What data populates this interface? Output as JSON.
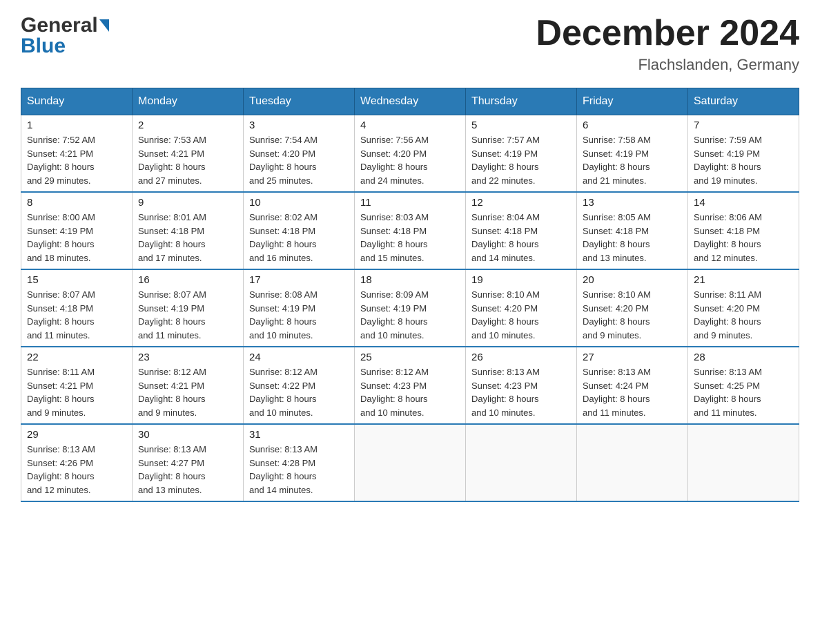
{
  "header": {
    "month_year": "December 2024",
    "location": "Flachslanden, Germany",
    "logo_general": "General",
    "logo_blue": "Blue"
  },
  "days_of_week": [
    "Sunday",
    "Monday",
    "Tuesday",
    "Wednesday",
    "Thursday",
    "Friday",
    "Saturday"
  ],
  "weeks": [
    [
      {
        "day": "1",
        "sunrise": "7:52 AM",
        "sunset": "4:21 PM",
        "daylight": "8 hours and 29 minutes."
      },
      {
        "day": "2",
        "sunrise": "7:53 AM",
        "sunset": "4:21 PM",
        "daylight": "8 hours and 27 minutes."
      },
      {
        "day": "3",
        "sunrise": "7:54 AM",
        "sunset": "4:20 PM",
        "daylight": "8 hours and 25 minutes."
      },
      {
        "day": "4",
        "sunrise": "7:56 AM",
        "sunset": "4:20 PM",
        "daylight": "8 hours and 24 minutes."
      },
      {
        "day": "5",
        "sunrise": "7:57 AM",
        "sunset": "4:19 PM",
        "daylight": "8 hours and 22 minutes."
      },
      {
        "day": "6",
        "sunrise": "7:58 AM",
        "sunset": "4:19 PM",
        "daylight": "8 hours and 21 minutes."
      },
      {
        "day": "7",
        "sunrise": "7:59 AM",
        "sunset": "4:19 PM",
        "daylight": "8 hours and 19 minutes."
      }
    ],
    [
      {
        "day": "8",
        "sunrise": "8:00 AM",
        "sunset": "4:19 PM",
        "daylight": "8 hours and 18 minutes."
      },
      {
        "day": "9",
        "sunrise": "8:01 AM",
        "sunset": "4:18 PM",
        "daylight": "8 hours and 17 minutes."
      },
      {
        "day": "10",
        "sunrise": "8:02 AM",
        "sunset": "4:18 PM",
        "daylight": "8 hours and 16 minutes."
      },
      {
        "day": "11",
        "sunrise": "8:03 AM",
        "sunset": "4:18 PM",
        "daylight": "8 hours and 15 minutes."
      },
      {
        "day": "12",
        "sunrise": "8:04 AM",
        "sunset": "4:18 PM",
        "daylight": "8 hours and 14 minutes."
      },
      {
        "day": "13",
        "sunrise": "8:05 AM",
        "sunset": "4:18 PM",
        "daylight": "8 hours and 13 minutes."
      },
      {
        "day": "14",
        "sunrise": "8:06 AM",
        "sunset": "4:18 PM",
        "daylight": "8 hours and 12 minutes."
      }
    ],
    [
      {
        "day": "15",
        "sunrise": "8:07 AM",
        "sunset": "4:18 PM",
        "daylight": "8 hours and 11 minutes."
      },
      {
        "day": "16",
        "sunrise": "8:07 AM",
        "sunset": "4:19 PM",
        "daylight": "8 hours and 11 minutes."
      },
      {
        "day": "17",
        "sunrise": "8:08 AM",
        "sunset": "4:19 PM",
        "daylight": "8 hours and 10 minutes."
      },
      {
        "day": "18",
        "sunrise": "8:09 AM",
        "sunset": "4:19 PM",
        "daylight": "8 hours and 10 minutes."
      },
      {
        "day": "19",
        "sunrise": "8:10 AM",
        "sunset": "4:20 PM",
        "daylight": "8 hours and 10 minutes."
      },
      {
        "day": "20",
        "sunrise": "8:10 AM",
        "sunset": "4:20 PM",
        "daylight": "8 hours and 9 minutes."
      },
      {
        "day": "21",
        "sunrise": "8:11 AM",
        "sunset": "4:20 PM",
        "daylight": "8 hours and 9 minutes."
      }
    ],
    [
      {
        "day": "22",
        "sunrise": "8:11 AM",
        "sunset": "4:21 PM",
        "daylight": "8 hours and 9 minutes."
      },
      {
        "day": "23",
        "sunrise": "8:12 AM",
        "sunset": "4:21 PM",
        "daylight": "8 hours and 9 minutes."
      },
      {
        "day": "24",
        "sunrise": "8:12 AM",
        "sunset": "4:22 PM",
        "daylight": "8 hours and 10 minutes."
      },
      {
        "day": "25",
        "sunrise": "8:12 AM",
        "sunset": "4:23 PM",
        "daylight": "8 hours and 10 minutes."
      },
      {
        "day": "26",
        "sunrise": "8:13 AM",
        "sunset": "4:23 PM",
        "daylight": "8 hours and 10 minutes."
      },
      {
        "day": "27",
        "sunrise": "8:13 AM",
        "sunset": "4:24 PM",
        "daylight": "8 hours and 11 minutes."
      },
      {
        "day": "28",
        "sunrise": "8:13 AM",
        "sunset": "4:25 PM",
        "daylight": "8 hours and 11 minutes."
      }
    ],
    [
      {
        "day": "29",
        "sunrise": "8:13 AM",
        "sunset": "4:26 PM",
        "daylight": "8 hours and 12 minutes."
      },
      {
        "day": "30",
        "sunrise": "8:13 AM",
        "sunset": "4:27 PM",
        "daylight": "8 hours and 13 minutes."
      },
      {
        "day": "31",
        "sunrise": "8:13 AM",
        "sunset": "4:28 PM",
        "daylight": "8 hours and 14 minutes."
      },
      null,
      null,
      null,
      null
    ]
  ],
  "labels": {
    "sunrise": "Sunrise:",
    "sunset": "Sunset:",
    "daylight": "Daylight:"
  }
}
